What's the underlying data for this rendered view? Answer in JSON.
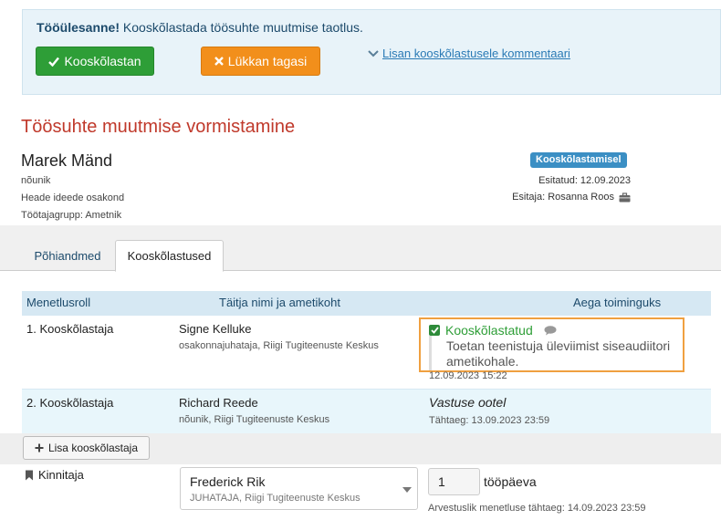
{
  "task": {
    "label": "Tööülesanne!",
    "text": "Kooskõlastada töösuhte muutmise taotlus.",
    "approve_label": "Kooskõlastan",
    "reject_label": "Lükkan tagasi",
    "comment_link": "Lisan kooskõlastusele kommentaari"
  },
  "page": {
    "title": "Töösuhte muutmise vormistamine"
  },
  "person": {
    "name": "Marek Mänd",
    "position": "nõunik",
    "department": "Heade ideede osakond",
    "group": "Töötajagrupp: Ametnik"
  },
  "status": {
    "badge": "Kooskõlastamisel",
    "submitted": "Esitatud: 12.09.2023",
    "submitter": "Esitaja: Rosanna Roos"
  },
  "tabs": [
    {
      "label": "Põhiandmed"
    },
    {
      "label": "Kooskõlastused"
    }
  ],
  "grid": {
    "headers": [
      "Menetlusroll",
      "Täitja nimi ja ametikoht",
      "Aega toiminguks"
    ],
    "rows": [
      {
        "role": "1. Kooskõlastaja",
        "name": "Signe Kelluke",
        "position": "osakonnajuhataja, Riigi Tugiteenuste Keskus",
        "status": "Kooskõlastatud",
        "comment": "Toetan teenistuja üleviimist siseaudiitori ametikohale.",
        "time": "12.09.2023 15:22"
      },
      {
        "role": "2. Kooskõlastaja",
        "name": "Richard Reede",
        "position": "nõunik, Riigi Tugiteenuste Keskus",
        "status": "Vastuse ootel",
        "deadline": "Tähtaeg: 13.09.2023 23:59"
      }
    ]
  },
  "add_button": "Lisa kooskõlastaja",
  "finalizer": {
    "label": "Kinnitaja",
    "name": "Frederick Rik",
    "position": "JUHATAJA, Riigi Tugiteenuste Keskus",
    "days": "1",
    "days_label": "tööpäeva",
    "deadline": "Arvestuslik menetluse tähtaeg: 14.09.2023 23:59"
  },
  "colors": {
    "accent_blue": "#3b8fc4",
    "approve_green": "#2e9e37",
    "reject_orange": "#f28f1b",
    "title_red": "#c0392b",
    "highlight_orange": "#f0a040"
  }
}
